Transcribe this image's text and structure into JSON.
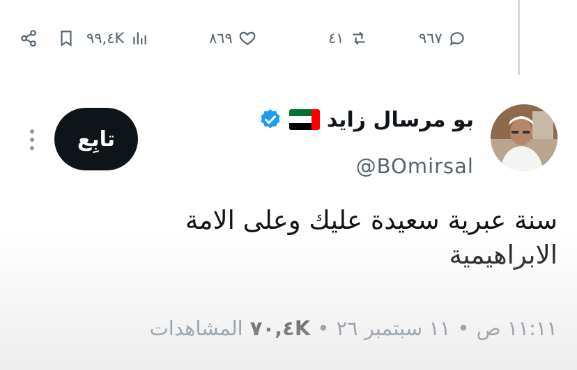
{
  "actions": {
    "replies": "٩٦٧",
    "reposts": "٤١",
    "likes": "٨٦٩",
    "views": "٩٩,٤K"
  },
  "author": {
    "display_name": "بو مرسال زايد",
    "handle": "@BOmirsal"
  },
  "follow_label": "تابِع",
  "tweet": {
    "line1": "سنة عبرية سعيدة عليك وعلى الامة",
    "line2": "الابراهيمية"
  },
  "meta": {
    "time": "١١:١١ ص",
    "date": "١١ سبتمبر ٢٦",
    "views_count": "٧٠,٤K",
    "views_label": "المشاهدات"
  },
  "colors": {
    "verified": "#1d9bf0",
    "text": "#0f1419",
    "muted": "#536471"
  },
  "icons": [
    "share-icon",
    "bookmark-icon",
    "views-icon",
    "like-icon",
    "repost-icon",
    "reply-icon",
    "verified-icon",
    "uae-flag-icon",
    "more-icon"
  ]
}
